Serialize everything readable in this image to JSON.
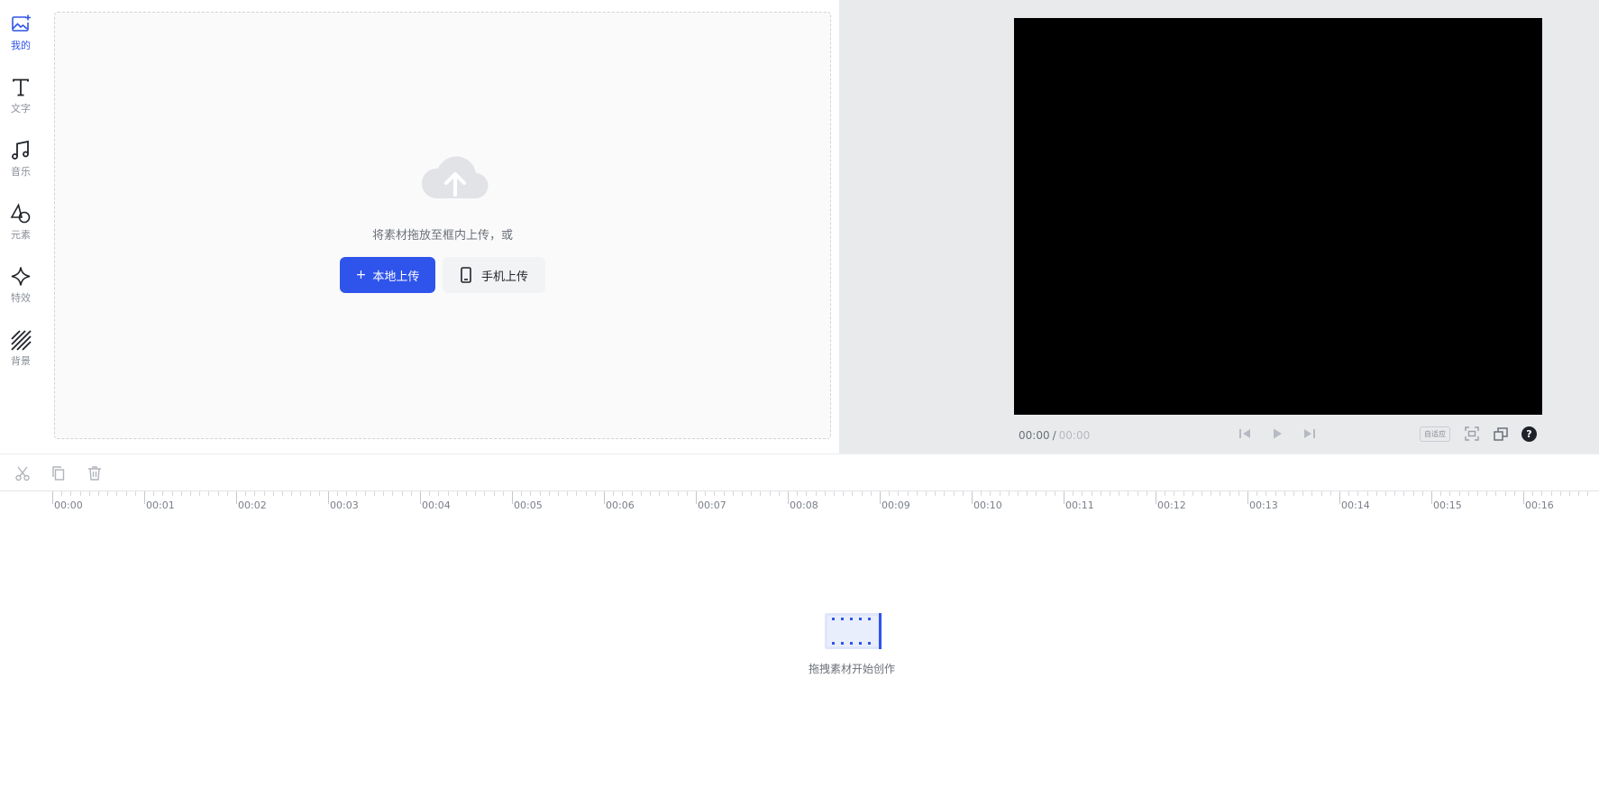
{
  "sidebar": {
    "items": [
      {
        "label": "我的",
        "icon": "add-media-icon",
        "active": true
      },
      {
        "label": "文字",
        "icon": "text-icon",
        "active": false
      },
      {
        "label": "音乐",
        "icon": "music-note-icon",
        "active": false
      },
      {
        "label": "元素",
        "icon": "shapes-icon",
        "active": false
      },
      {
        "label": "特效",
        "icon": "sparkle-icon",
        "active": false
      },
      {
        "label": "背景",
        "icon": "background-stripes-icon",
        "active": false
      }
    ]
  },
  "material_panel": {
    "drop_hint": "将素材拖放至框内上传，或",
    "local_upload_label": "本地上传",
    "phone_upload_label": "手机上传",
    "cloud_icon": "cloud-upload-icon"
  },
  "preview": {
    "current_time": "00:00",
    "separator": "/",
    "total_time": "00:00",
    "auto_fit_label": "自适应",
    "controls": [
      "skip-back-icon",
      "play-icon",
      "skip-forward-icon",
      "fit-screen-icon",
      "window-icon",
      "help-icon"
    ],
    "help_label": "?"
  },
  "timeline": {
    "tools": [
      "scissors-icon",
      "copy-icon",
      "trash-icon"
    ],
    "ruler_labels": [
      "00:00",
      "00:01",
      "00:02",
      "00:03",
      "00:04",
      "00:05",
      "00:06",
      "00:07",
      "00:08",
      "00:09",
      "00:10",
      "00:11",
      "00:12",
      "00:13",
      "00:14",
      "00:15",
      "00:16"
    ],
    "empty_hint": "拖拽素材开始创作"
  },
  "colors": {
    "accent": "#2f54eb",
    "preview_bg": "#e9eaec",
    "canvas": "#000000"
  }
}
